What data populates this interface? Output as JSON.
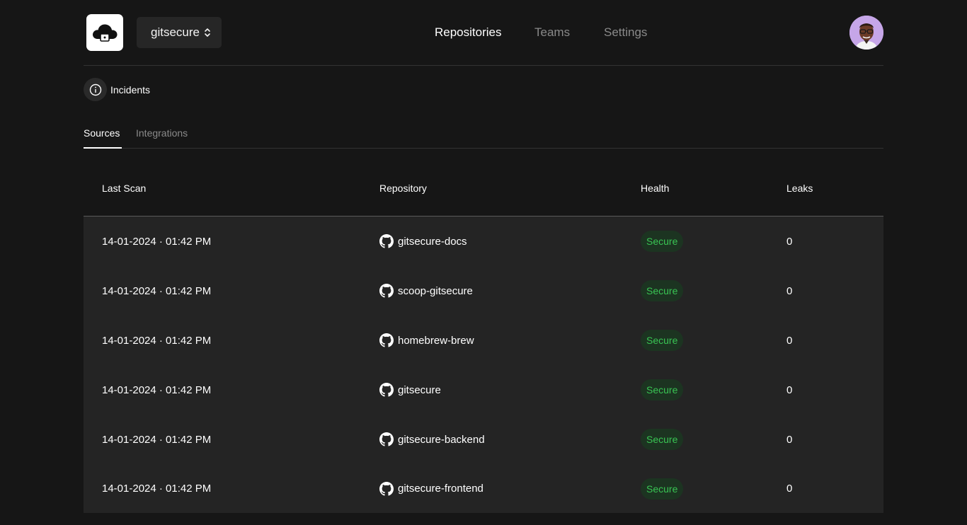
{
  "header": {
    "logo_icon": "cloud-lock-icon",
    "org_name": "gitsecure",
    "nav": [
      {
        "label": "Repositories",
        "active": true
      },
      {
        "label": "Teams",
        "active": false
      },
      {
        "label": "Settings",
        "active": false
      }
    ],
    "avatar_icon": "user-avatar"
  },
  "incidents": {
    "label": "Incidents",
    "icon": "info-icon"
  },
  "tabs": [
    {
      "label": "Sources",
      "active": true
    },
    {
      "label": "Integrations",
      "active": false
    }
  ],
  "table": {
    "columns": [
      "Last Scan",
      "Repository",
      "Health",
      "Leaks"
    ],
    "rows": [
      {
        "last_scan": "14-01-2024 · 01:42 PM",
        "repository": "gitsecure-docs",
        "health": "Secure",
        "leaks": "0"
      },
      {
        "last_scan": "14-01-2024 · 01:42 PM",
        "repository": "scoop-gitsecure",
        "health": "Secure",
        "leaks": "0"
      },
      {
        "last_scan": "14-01-2024 · 01:42 PM",
        "repository": "homebrew-brew",
        "health": "Secure",
        "leaks": "0"
      },
      {
        "last_scan": "14-01-2024 · 01:42 PM",
        "repository": "gitsecure",
        "health": "Secure",
        "leaks": "0"
      },
      {
        "last_scan": "14-01-2024 · 01:42 PM",
        "repository": "gitsecure-backend",
        "health": "Secure",
        "leaks": "0"
      },
      {
        "last_scan": "14-01-2024 · 01:42 PM",
        "repository": "gitsecure-frontend",
        "health": "Secure",
        "leaks": "0"
      }
    ]
  },
  "colors": {
    "background": "#161616",
    "table_body": "#242424",
    "secure_text": "#39c453",
    "secure_bg": "#1c3421",
    "inactive_text": "#8a8a8a"
  }
}
